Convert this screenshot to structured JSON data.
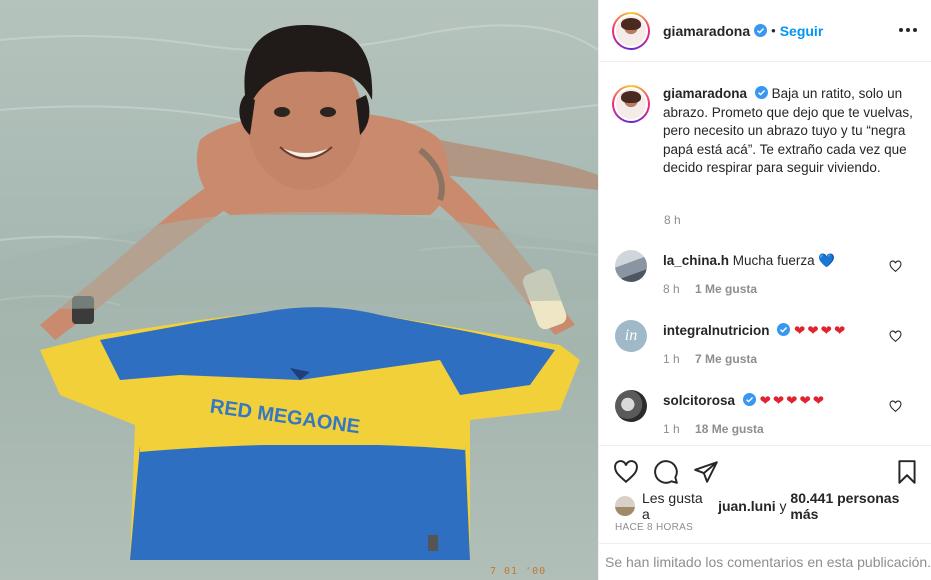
{
  "post": {
    "username": "giamaradona",
    "follow_label": "Seguir",
    "separator": "•"
  },
  "caption": {
    "username": "giamaradona",
    "text": "Baja un ratito, solo un abrazo. Prometo que dejo que te vuelvas, pero necesito un abrazo tuyo y tu “negra papá está acá”. Te extraño cada vez que decido respirar para seguir viviendo.",
    "time": "8 h"
  },
  "comments": [
    {
      "username": "la_china.h",
      "text": "Mucha fuerza",
      "emoji": "💙",
      "time": "8 h",
      "likes": "1 Me gusta",
      "verified": false
    },
    {
      "username": "integralnutricion",
      "text": "",
      "emoji": "❤❤❤❤",
      "time": "1 h",
      "likes": "7 Me gusta",
      "verified": true
    },
    {
      "username": "solcitorosa",
      "text": "",
      "emoji": "❤❤❤❤❤",
      "time": "1 h",
      "likes": "18 Me gusta",
      "verified": true
    }
  ],
  "likes": {
    "prefix": "Les gusta a",
    "user": "juan.luni",
    "connector": "y",
    "count": "80.441 personas más"
  },
  "posted_ago": "HACE 8 HORAS",
  "comments_limited": "Se han limitado los comentarios en esta publicación.",
  "photo": {
    "date_stamp": "7 01  '00"
  },
  "colors": {
    "link": "#0095f6",
    "muted": "#8e8e8e",
    "heart_red": "#ed4956",
    "blue_heart": "#1f6fd6"
  }
}
